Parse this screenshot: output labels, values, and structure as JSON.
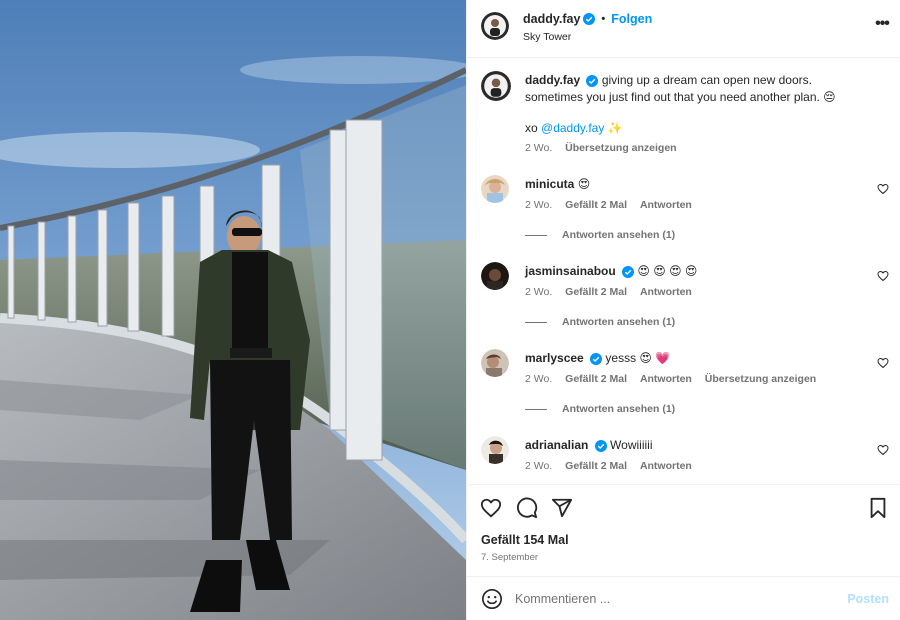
{
  "photo": {
    "alt": ""
  },
  "header": {
    "username": "daddy.fay",
    "follow_label": "Folgen",
    "location": "Sky Tower",
    "separator": "•"
  },
  "caption": {
    "username": "daddy.fay",
    "line1": "giving up a dream can open new doors.",
    "line2": "sometimes you just find out that you need another plan. 😔",
    "xo": "xo",
    "mention": "@daddy.fay",
    "sparkle": "✨",
    "age": "2 Wo.",
    "translate": "Übersetzung anzeigen"
  },
  "comments": [
    {
      "username": "minicuta",
      "text": "😍",
      "age": "2 Wo.",
      "likes": "Gefällt 2 Mal",
      "reply": "Antworten",
      "translate": "",
      "view_replies": "Antworten ansehen (1)"
    },
    {
      "username": "jasminsainabou",
      "text": "😍 😍 😍 😍",
      "age": "2 Wo.",
      "likes": "Gefällt 2 Mal",
      "reply": "Antworten",
      "translate": "",
      "view_replies": "Antworten ansehen (1)"
    },
    {
      "username": "marlyscee",
      "text": "yesss 😍 💗",
      "age": "2 Wo.",
      "likes": "Gefällt 2 Mal",
      "reply": "Antworten",
      "translate": "Übersetzung anzeigen",
      "view_replies": "Antworten ansehen (1)"
    },
    {
      "username": "adrianalian",
      "text": "Wowiiiiii",
      "age": "2 Wo.",
      "likes": "Gefällt 2 Mal",
      "reply": "Antworten",
      "translate": "",
      "view_replies": ""
    }
  ],
  "actions": {
    "likes_label": "Gefällt 154 Mal",
    "date": "7. September",
    "icons": [
      "heart-icon",
      "comment-icon",
      "share-icon",
      "bookmark-icon"
    ]
  },
  "composer": {
    "placeholder": "Kommentieren ...",
    "post_label": "Posten"
  },
  "colors": {
    "accent": "#0095f6",
    "post_disabled": "#b2dffc",
    "muted": "#737373",
    "text": "#262626"
  }
}
